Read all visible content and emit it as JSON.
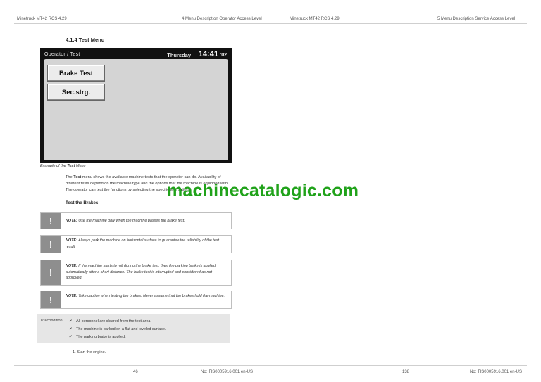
{
  "header": {
    "left_title": "Minetruck MT42 RCS 4.29",
    "left_section": "4 Menu Description Operator Access Level",
    "right_title": "Minetruck MT42 RCS 4.29",
    "right_section": "5 Menu Description Service Access Level"
  },
  "section_heading": "4.1.4 Test Menu",
  "screen": {
    "title": "Operator / Test",
    "day": "Thursday",
    "time_hm": "14:41",
    "time_s": ":02",
    "buttons": [
      "Brake Test",
      "Sec.strg."
    ]
  },
  "caption": {
    "prefix": "Example of the ",
    "bold": "Test",
    "suffix": " Menu"
  },
  "body": {
    "pre": "The ",
    "bold": "Test",
    "text": " menu shows the available machine tests that the operator can do. Availability of different tests depend on the machine type and the options that the machine is equipped with. The operator can test the functions by selecting the specific test button."
  },
  "subheading": "Test the Brakes",
  "notes": [
    {
      "label": "NOTE:",
      "text": " Use the machine only when the machine passes the brake test."
    },
    {
      "label": "NOTE:",
      "text": " Always park the machine on horizontal surface to guarantee the reliability of the test result."
    },
    {
      "label": "NOTE:",
      "text": " If the machine starts to roll during the brake test, then the parking brake is applied automatically after a short distance. The brake test is interrupted and considered as not approved."
    },
    {
      "label": "NOTE:",
      "text": " Take caution when testing the brakes. Never assume that the brakes hold the machine."
    }
  ],
  "note_icon": "!",
  "precondition": {
    "label": "Precondition",
    "check_symbol": "✔",
    "items": [
      "All personnel are cleared from the test area.",
      "The machine is parked on a flat and leveled surface.",
      "The parking brake is applied."
    ]
  },
  "steps": [
    "1.  Start the engine."
  ],
  "footer": {
    "left_page": "46",
    "left_doc": "No: TIS0005916.001 en-US",
    "right_page": "138",
    "right_doc": "No: TIS0005916.001 en-US"
  },
  "watermark": "machinecatalogic.com"
}
